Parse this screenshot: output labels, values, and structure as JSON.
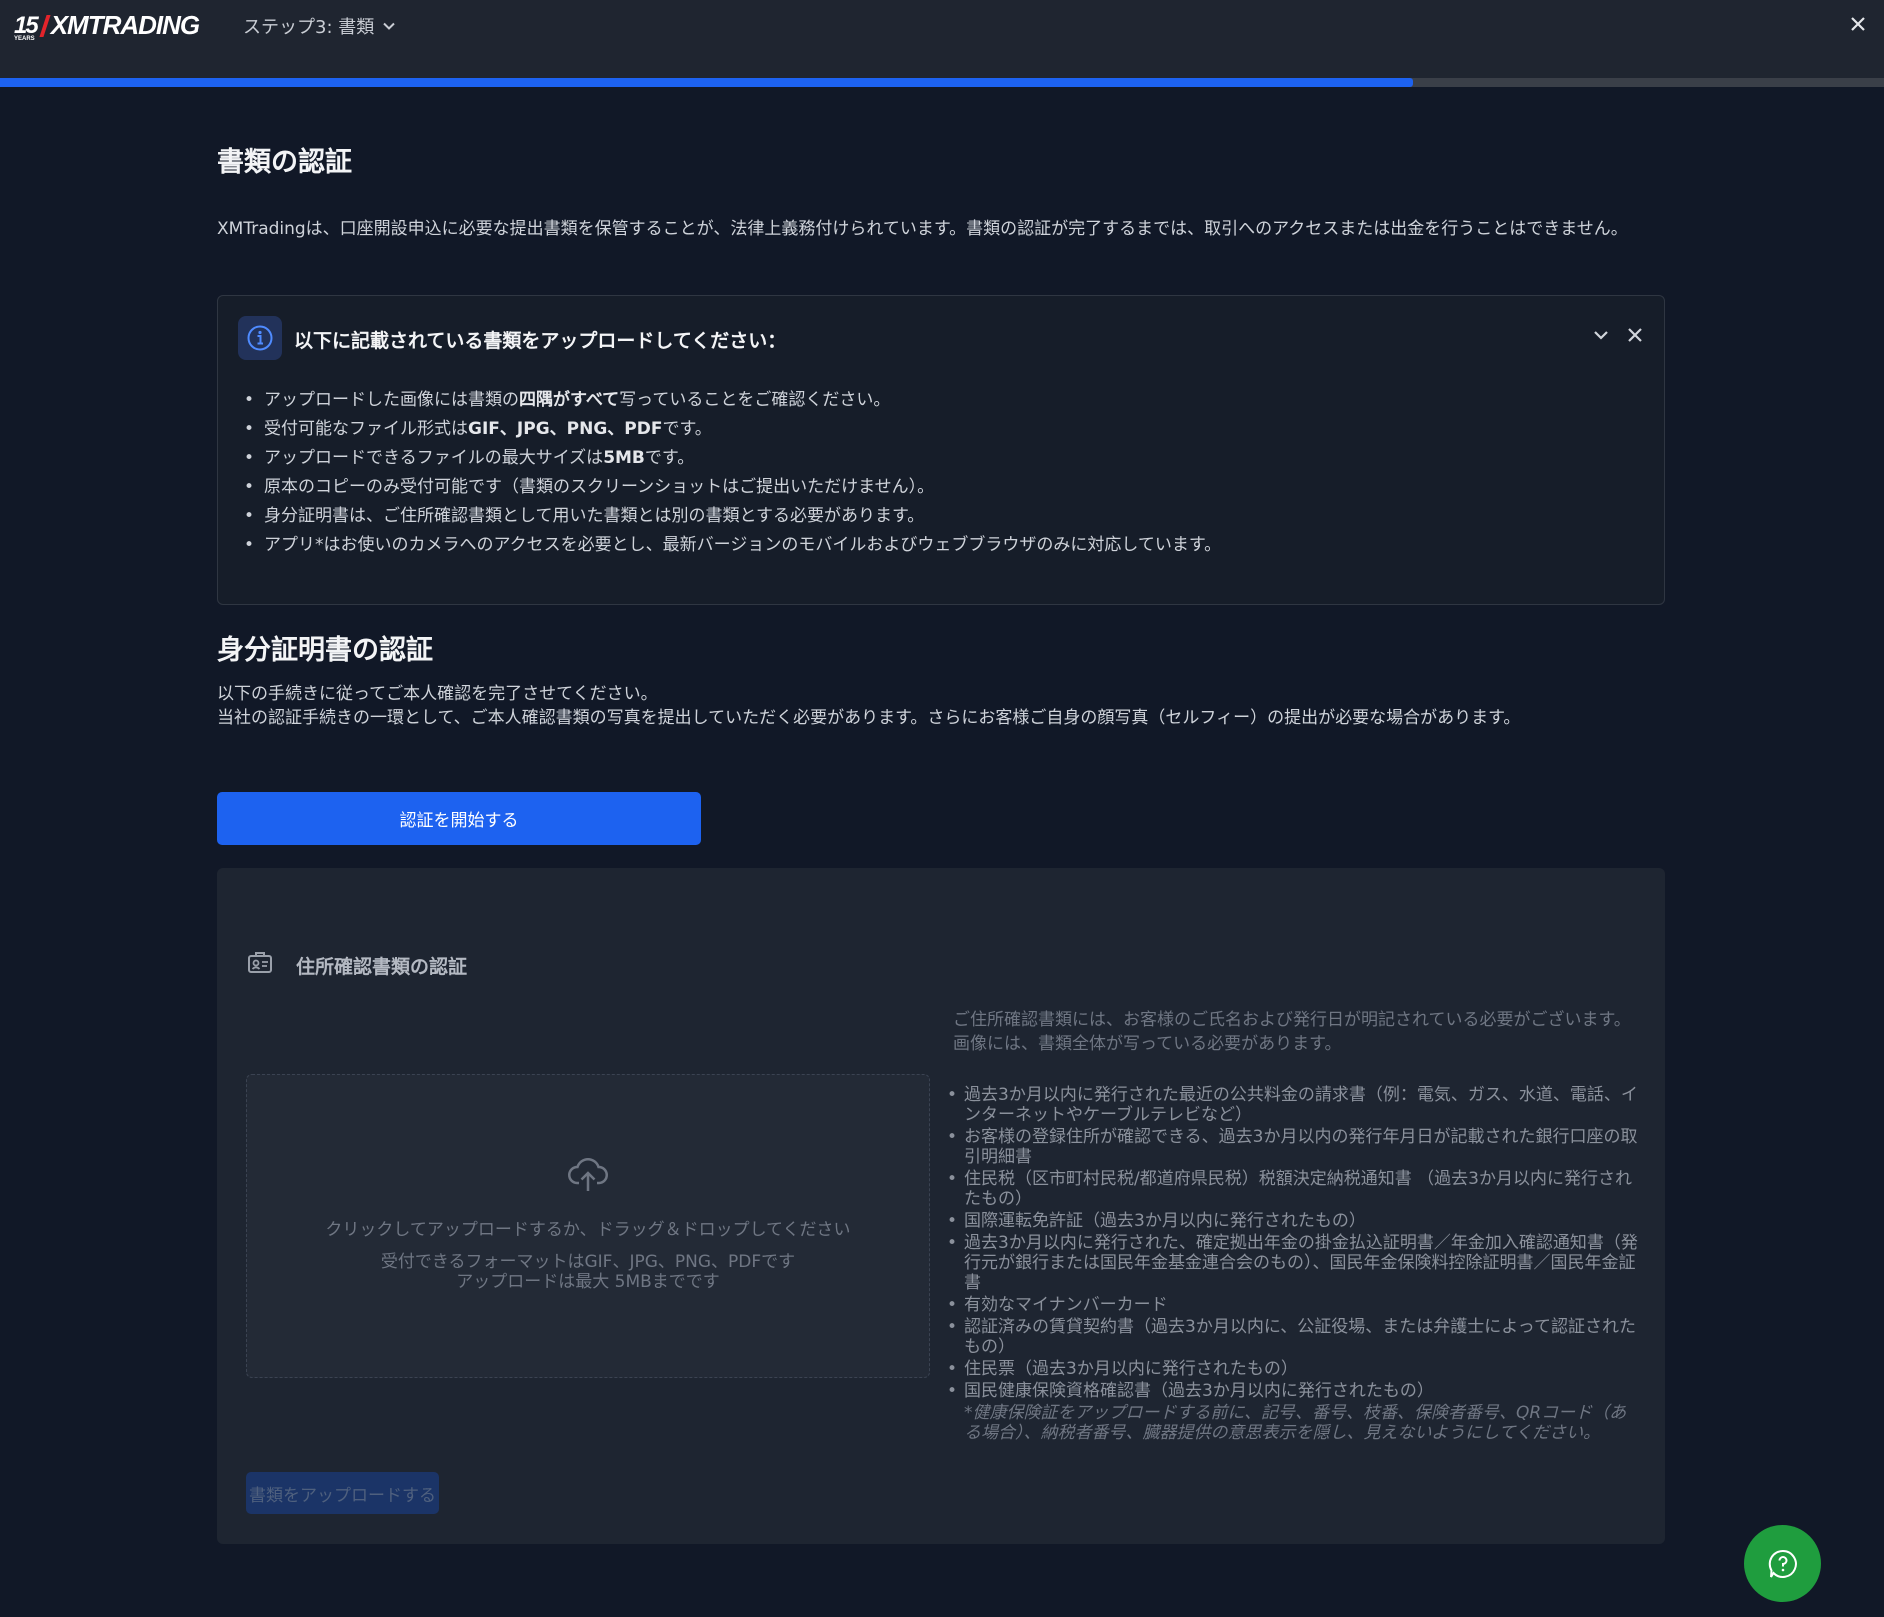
{
  "header": {
    "logo_years_number": "15",
    "logo_years_word": "YEARS",
    "logo_brand": "XMTRADING",
    "step_label": "ステップ3: 書類",
    "progress_percent": 75,
    "accent_color": "#1d62f0"
  },
  "documents": {
    "title": "書類の認証",
    "description": "XMTradingは、口座開設申込に必要な提出書類を保管することが、法律上義務付けられています。書類の認証が完了するまでは、取引へのアクセスまたは出金を行うことはできません。"
  },
  "info_box": {
    "icon": "info-icon",
    "title": "以下に記載されている書類をアップロードしてください：",
    "items": [
      {
        "pre": "アップロードした画像には書類の",
        "bold": "四隅がすべて",
        "post": "写っていることをご確認ください。"
      },
      {
        "pre": "受付可能なファイル形式は",
        "bold": "GIF、JPG、PNG、PDF",
        "post": "です。"
      },
      {
        "pre": "アップロードできるファイルの最大サイズは",
        "bold": "5MB",
        "post": "です。"
      },
      {
        "pre": "原本のコピーのみ受付可能です（書類のスクリーンショットはご提出いただけません）。",
        "bold": "",
        "post": ""
      },
      {
        "pre": "身分証明書は、ご住所確認書類として用いた書類とは別の書類とする必要があります。",
        "bold": "",
        "post": ""
      },
      {
        "pre": "アプリ*はお使いのカメラへのアクセスを必要とし、最新バージョンのモバイルおよびウェブブラウザのみに対応しています。",
        "bold": "",
        "post": ""
      }
    ]
  },
  "identity": {
    "title": "身分証明書の認証",
    "desc_line1": "以下の手続きに従ってご本人確認を完了させてください。",
    "desc_line2": "当社の認証手続きの一環として、ご本人確認書類の写真を提出していただく必要があります。さらにお客様ご自身の顔写真（セルフィー）の提出が必要な場合があります。",
    "start_button": "認証を開始する"
  },
  "address": {
    "icon": "id-card-icon",
    "title": "住所確認書類の認証",
    "dropzone_main": "クリックしてアップロードするか、ドラッグ＆ドロップしてください",
    "dropzone_formats": "受付できるフォーマットはGIF、JPG、PNG、PDFです",
    "dropzone_size": "アップロードは最大 5MBまでです",
    "note_line1": "ご住所確認書類には、お客様のご氏名および発行日が明記されている必要がございます。",
    "note_line2": "画像には、書類全体が写っている必要があります。",
    "documents": [
      "過去3か月以内に発行された最近の公共料金の請求書（例：電気、ガス、水道、電話、インターネットやケーブルテレビなど）",
      "お客様の登録住所が確認できる、過去3か月以内の発行年月日が記載された銀行口座の取引明細書",
      "住民税（区市町村民税/都道府県民税）税額決定納税通知書 （過去3か月以内に発行されたもの）",
      "国際運転免許証（過去3か月以内に発行されたもの）",
      "過去3か月以内に発行された、確定拠出年金の掛金払込証明書／年金加入確認通知書（発行元が銀行または国民年金基金連合会のもの）、国民年金保険料控除証明書／国民年金証書",
      "有効なマイナンバーカード",
      "認証済みの賃貸契約書（過去3か月以内に、公証役場、または弁護士によって認証されたもの）",
      "住民票（過去3か月以内に発行されたもの）",
      "国民健康保険資格確認書（過去3か月以内に発行されたもの）"
    ],
    "insurance_note": "*健康保険証をアップロードする前に、記号、番号、枝番、保険者番号、QRコード（ある場合）、納税者番号、臓器提供の意思表示を隠し、見えないようにしてください。",
    "upload_button": "書類をアップロードする"
  },
  "chat": {
    "icon": "help-chat-icon",
    "color": "#1f9d3e"
  }
}
